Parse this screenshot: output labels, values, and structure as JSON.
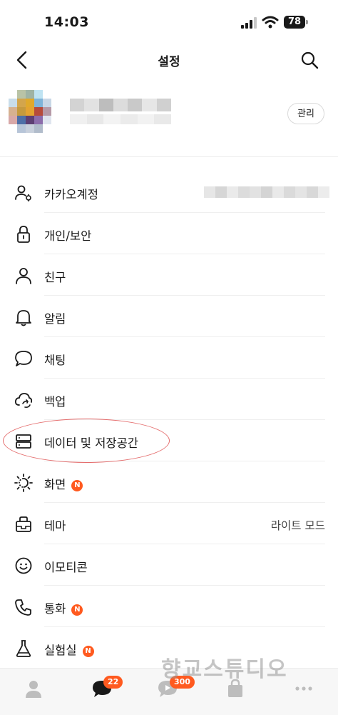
{
  "status_bar": {
    "time": "14:03",
    "battery": "78"
  },
  "nav": {
    "title": "설정"
  },
  "profile": {
    "manage_label": "관리"
  },
  "settings": [
    {
      "label": "카카오계정",
      "icon": "account-icon"
    },
    {
      "label": "개인/보안",
      "icon": "lock-icon"
    },
    {
      "label": "친구",
      "icon": "person-icon"
    },
    {
      "label": "알림",
      "icon": "bell-icon"
    },
    {
      "label": "채팅",
      "icon": "chat-bubble-icon"
    },
    {
      "label": "백업",
      "icon": "cloud-sync-icon"
    },
    {
      "label": "데이터 및 저장공간",
      "icon": "storage-icon"
    },
    {
      "label": "화면",
      "icon": "brightness-icon",
      "badge": "N"
    },
    {
      "label": "테마",
      "icon": "theme-icon",
      "value": "라이트 모드"
    },
    {
      "label": "이모티콘",
      "icon": "emoticon-icon"
    },
    {
      "label": "통화",
      "icon": "phone-icon",
      "badge": "N"
    },
    {
      "label": "실험실",
      "icon": "flask-icon",
      "badge": "N"
    }
  ],
  "tabs": [
    {
      "name": "friends",
      "icon": "person-tab-icon"
    },
    {
      "name": "chats",
      "icon": "chat-tab-icon",
      "badge": "22"
    },
    {
      "name": "openchat",
      "icon": "openchat-tab-icon",
      "badge": "300"
    },
    {
      "name": "shopping",
      "icon": "shopping-bag-icon"
    },
    {
      "name": "more",
      "icon": "more-icon"
    }
  ],
  "watermark": "향교스튜디오",
  "colors": {
    "accent_badge": "#ff5a1f",
    "highlight": "#e46c6c"
  }
}
